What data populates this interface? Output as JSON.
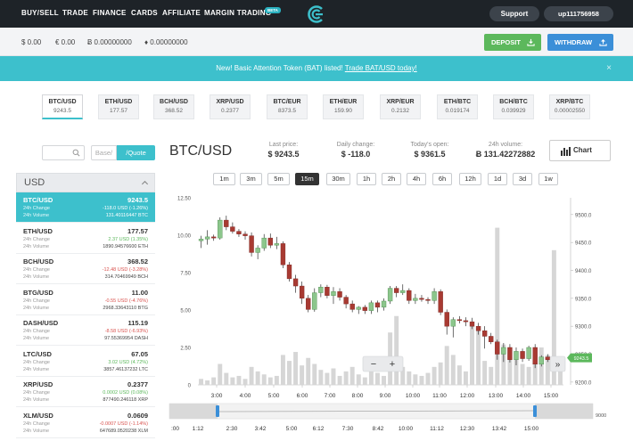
{
  "nav": {
    "items": [
      "BUY/SELL",
      "TRADE",
      "FINANCE",
      "CARDS",
      "AFFILIATE",
      "MARGIN TRADING"
    ],
    "beta_badge": "BETA",
    "support": "Support",
    "account": "up111756958"
  },
  "balances": [
    "$ 0.00",
    "€ 0.00",
    "Ƀ 0.00000000",
    "♦ 0.00000000"
  ],
  "actions": {
    "deposit": "DEPOSIT",
    "withdraw": "WITHDRAW"
  },
  "announcement": {
    "text": "New! Basic Attention Token (BAT) listed!",
    "link": "Trade BAT/USD today!",
    "close": "×"
  },
  "pairs": [
    {
      "name": "BTC/USD",
      "price": "9243.5"
    },
    {
      "name": "ETH/USD",
      "price": "177.57"
    },
    {
      "name": "BCH/USD",
      "price": "368.52"
    },
    {
      "name": "XRP/USD",
      "price": "0.2377"
    },
    {
      "name": "BTC/EUR",
      "price": "8373.5"
    },
    {
      "name": "ETH/EUR",
      "price": "159.90"
    },
    {
      "name": "XRP/EUR",
      "price": "0.2132"
    },
    {
      "name": "ETH/BTC",
      "price": "0.019174"
    },
    {
      "name": "BCH/BTC",
      "price": "0.039929"
    },
    {
      "name": "XRP/BTC",
      "price": "0.00002550"
    }
  ],
  "filter": {
    "search_placeholder": "",
    "base": "Base/",
    "quote": "/Quote"
  },
  "market_list": {
    "heading": "USD",
    "change_label": "24h Change",
    "volume_label": "24h Volume",
    "rows": [
      {
        "pair": "BTC/USD",
        "price": "9243.5",
        "change": "-118.0 USD (-1.26%)",
        "dir": "neg",
        "volume": "131.40116447 BTC"
      },
      {
        "pair": "ETH/USD",
        "price": "177.57",
        "change": "2.37 USD (1.35%)",
        "dir": "pos",
        "volume": "1890.94576600 ETH"
      },
      {
        "pair": "BCH/USD",
        "price": "368.52",
        "change": "-12.48 USD (-3.28%)",
        "dir": "neg",
        "volume": "314.70469949 BCH"
      },
      {
        "pair": "BTG/USD",
        "price": "11.00",
        "change": "-0.55 USD (-4.76%)",
        "dir": "neg",
        "volume": "2968.33643110 BTG"
      },
      {
        "pair": "DASH/USD",
        "price": "115.19",
        "change": "-8.58 USD (-6.93%)",
        "dir": "neg",
        "volume": "97.55369954 DASH"
      },
      {
        "pair": "LTC/USD",
        "price": "67.05",
        "change": "3.02 USD (4.72%)",
        "dir": "pos",
        "volume": "3857.46137232 LTC"
      },
      {
        "pair": "XRP/USD",
        "price": "0.2377",
        "change": "0.0002 USD (0.08%)",
        "dir": "pos",
        "volume": "877490.246118 XRP"
      },
      {
        "pair": "XLM/USD",
        "price": "0.0609",
        "change": "-0.0007 USD (-1.14%)",
        "dir": "neg",
        "volume": "647689.0520238 XLM"
      }
    ]
  },
  "chart_header": {
    "title": "BTC/USD",
    "last_price_label": "Last price:",
    "last_price": "$ 9243.5",
    "daily_change_label": "Daily change:",
    "daily_change": "$ -118.0",
    "todays_open_label": "Today's open:",
    "todays_open": "$ 9361.5",
    "volume_label": "24h volume:",
    "volume": "Ƀ 131.42272882",
    "chart_button": "Chart"
  },
  "timeframes": [
    "1m",
    "3m",
    "5m",
    "15m",
    "30m",
    "1h",
    "2h",
    "4h",
    "6h",
    "12h",
    "1d",
    "3d",
    "1w"
  ],
  "active_timeframe": "15m",
  "zoom": {
    "minus": "−",
    "plus": "+",
    "forward": "»"
  },
  "chart_data": {
    "type": "candlestick",
    "x_ticks": [
      "3:00",
      "4:00",
      "5:00",
      "6:00",
      "7:00",
      "8:00",
      "9:00",
      "10:00",
      "11:00",
      "12:00",
      "13:00",
      "14:00",
      "15:00"
    ],
    "price_ticks": [
      "9500.0",
      "9450.0",
      "9400.0",
      "9350.0",
      "9300.0",
      "9250.0",
      "9200.0"
    ],
    "volume_ticks": [
      "0",
      "2.50",
      "5.00",
      "7.50",
      "10.00",
      "12.50"
    ],
    "price_range": [
      9195,
      9530
    ],
    "volume_range": [
      0,
      12.5
    ],
    "last_price_marker": "9243.5",
    "up_color": "#8cc68c",
    "down_color": "#a83a32",
    "candles": [
      [
        9453,
        9462,
        9440,
        9456
      ],
      [
        9456,
        9472,
        9446,
        9460
      ],
      [
        9460,
        9464,
        9453,
        9458
      ],
      [
        9458,
        9495,
        9455,
        9490
      ],
      [
        9490,
        9498,
        9472,
        9478
      ],
      [
        9478,
        9486,
        9466,
        9470
      ],
      [
        9470,
        9474,
        9460,
        9465
      ],
      [
        9465,
        9470,
        9455,
        9462
      ],
      [
        9462,
        9468,
        9425,
        9432
      ],
      [
        9432,
        9445,
        9420,
        9440
      ],
      [
        9440,
        9465,
        9435,
        9458
      ],
      [
        9458,
        9466,
        9440,
        9445
      ],
      [
        9445,
        9460,
        9438,
        9448
      ],
      [
        9448,
        9452,
        9404,
        9410
      ],
      [
        9410,
        9415,
        9380,
        9385
      ],
      [
        9385,
        9392,
        9360,
        9372
      ],
      [
        9372,
        9380,
        9340,
        9350
      ],
      [
        9350,
        9356,
        9325,
        9330
      ],
      [
        9330,
        9368,
        9326,
        9360
      ],
      [
        9360,
        9375,
        9352,
        9370
      ],
      [
        9370,
        9374,
        9350,
        9355
      ],
      [
        9355,
        9370,
        9340,
        9362
      ],
      [
        9362,
        9368,
        9346,
        9352
      ],
      [
        9352,
        9356,
        9332,
        9340
      ],
      [
        9340,
        9346,
        9325,
        9330
      ],
      [
        9330,
        9336,
        9322,
        9334
      ],
      [
        9334,
        9338,
        9322,
        9328
      ],
      [
        9328,
        9346,
        9322,
        9342
      ],
      [
        9342,
        9346,
        9325,
        9334
      ],
      [
        9334,
        9350,
        9328,
        9345
      ],
      [
        9345,
        9372,
        9340,
        9368
      ],
      [
        9368,
        9372,
        9352,
        9360
      ],
      [
        9360,
        9375,
        9356,
        9364
      ],
      [
        9364,
        9368,
        9340,
        9346
      ],
      [
        9346,
        9358,
        9340,
        9350
      ],
      [
        9350,
        9356,
        9344,
        9348
      ],
      [
        9348,
        9352,
        9340,
        9346
      ],
      [
        9346,
        9368,
        9340,
        9362
      ],
      [
        9362,
        9366,
        9320,
        9325
      ],
      [
        9325,
        9330,
        9285,
        9300
      ],
      [
        9300,
        9316,
        9280,
        9312
      ],
      [
        9312,
        9318,
        9305,
        9310
      ],
      [
        9310,
        9316,
        9300,
        9308
      ],
      [
        9308,
        9315,
        9295,
        9300
      ],
      [
        9300,
        9306,
        9285,
        9292
      ],
      [
        9292,
        9300,
        9260,
        9282
      ],
      [
        9282,
        9288,
        9268,
        9272
      ],
      [
        9272,
        9276,
        9240,
        9250
      ],
      [
        9250,
        9270,
        9236,
        9262
      ],
      [
        9262,
        9268,
        9235,
        9240
      ],
      [
        9240,
        9262,
        9230,
        9255
      ],
      [
        9255,
        9260,
        9236,
        9242
      ],
      [
        9242,
        9265,
        9238,
        9262
      ],
      [
        9262,
        9268,
        9225,
        9232
      ],
      [
        9232,
        9248,
        9228,
        9245
      ],
      [
        9245,
        9250,
        9236,
        9240
      ],
      [
        9240,
        9244,
        9232,
        9238
      ],
      [
        9238,
        9246,
        9234,
        9243.5
      ]
    ],
    "volumes": [
      0.4,
      0.3,
      0.5,
      1.4,
      0.8,
      0.5,
      0.6,
      0.4,
      1.2,
      0.9,
      0.7,
      0.5,
      0.6,
      2.0,
      1.6,
      2.2,
      1.3,
      1.8,
      1.4,
      1.0,
      0.8,
      1.1,
      0.6,
      0.9,
      1.2,
      0.7,
      0.5,
      1.0,
      0.8,
      0.6,
      3.5,
      4.6,
      1.2,
      0.9,
      0.7,
      0.6,
      0.8,
      1.2,
      1.5,
      2.6,
      2.0,
      1.3,
      0.9,
      4.0,
      3.8,
      1.6,
      1.2,
      10.5,
      2.7,
      2.2,
      1.8,
      1.4,
      1.2,
      1.6,
      2.5,
      2.0,
      9.0,
      1.5
    ]
  }
}
